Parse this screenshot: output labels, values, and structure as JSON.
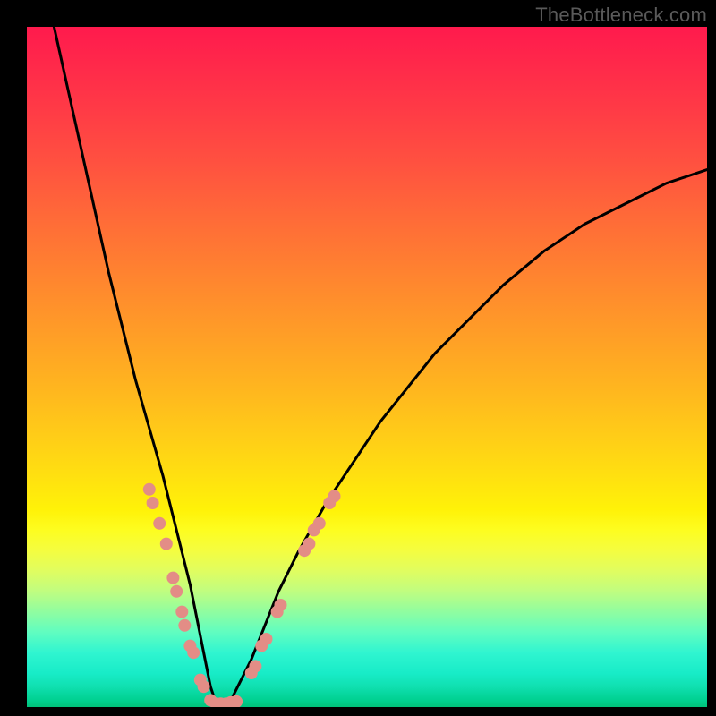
{
  "watermark": "TheBottleneck.com",
  "chart_data": {
    "type": "line",
    "title": "",
    "xlabel": "",
    "ylabel": "",
    "xlim": [
      0,
      100
    ],
    "ylim": [
      0,
      100
    ],
    "grid": false,
    "legend": false,
    "annotations": [],
    "description": "V-shaped bottleneck curve over rainbow gradient (red high → green low). Minimum near x≈27, y≈0. Salmon-pink dots cluster along both branches in the lower band (y ≈ 8–32) and along the trough.",
    "series": [
      {
        "name": "curve",
        "x": [
          4,
          6,
          8,
          10,
          12,
          14,
          16,
          18,
          20,
          22,
          23,
          24,
          25,
          26,
          27,
          28,
          29,
          30,
          31,
          33,
          35,
          37,
          40,
          44,
          48,
          52,
          56,
          60,
          65,
          70,
          76,
          82,
          88,
          94,
          100
        ],
        "y": [
          100,
          91,
          82,
          73,
          64,
          56,
          48,
          41,
          34,
          26,
          22,
          18,
          13,
          8,
          3,
          0,
          0,
          1,
          3,
          7,
          12,
          17,
          23,
          30,
          36,
          42,
          47,
          52,
          57,
          62,
          67,
          71,
          74,
          77,
          79
        ]
      }
    ],
    "dots": {
      "color": "#e38d86",
      "points": [
        {
          "x": 18.0,
          "y": 32
        },
        {
          "x": 18.5,
          "y": 30
        },
        {
          "x": 19.5,
          "y": 27
        },
        {
          "x": 20.5,
          "y": 24
        },
        {
          "x": 21.5,
          "y": 19
        },
        {
          "x": 22.0,
          "y": 17
        },
        {
          "x": 22.8,
          "y": 14
        },
        {
          "x": 23.2,
          "y": 12
        },
        {
          "x": 24.0,
          "y": 9
        },
        {
          "x": 24.5,
          "y": 8
        },
        {
          "x": 25.5,
          "y": 4
        },
        {
          "x": 26.0,
          "y": 3
        },
        {
          "x": 27.0,
          "y": 1
        },
        {
          "x": 27.8,
          "y": 0.5
        },
        {
          "x": 28.5,
          "y": 0.5
        },
        {
          "x": 29.3,
          "y": 0.5
        },
        {
          "x": 30.0,
          "y": 0.7
        },
        {
          "x": 30.8,
          "y": 0.8
        },
        {
          "x": 33.0,
          "y": 5
        },
        {
          "x": 33.6,
          "y": 6
        },
        {
          "x": 34.5,
          "y": 9
        },
        {
          "x": 35.2,
          "y": 10
        },
        {
          "x": 36.8,
          "y": 14
        },
        {
          "x": 37.3,
          "y": 15
        },
        {
          "x": 40.8,
          "y": 23
        },
        {
          "x": 41.5,
          "y": 24
        },
        {
          "x": 42.2,
          "y": 26
        },
        {
          "x": 43.0,
          "y": 27
        },
        {
          "x": 44.5,
          "y": 30
        },
        {
          "x": 45.2,
          "y": 31
        }
      ]
    }
  }
}
